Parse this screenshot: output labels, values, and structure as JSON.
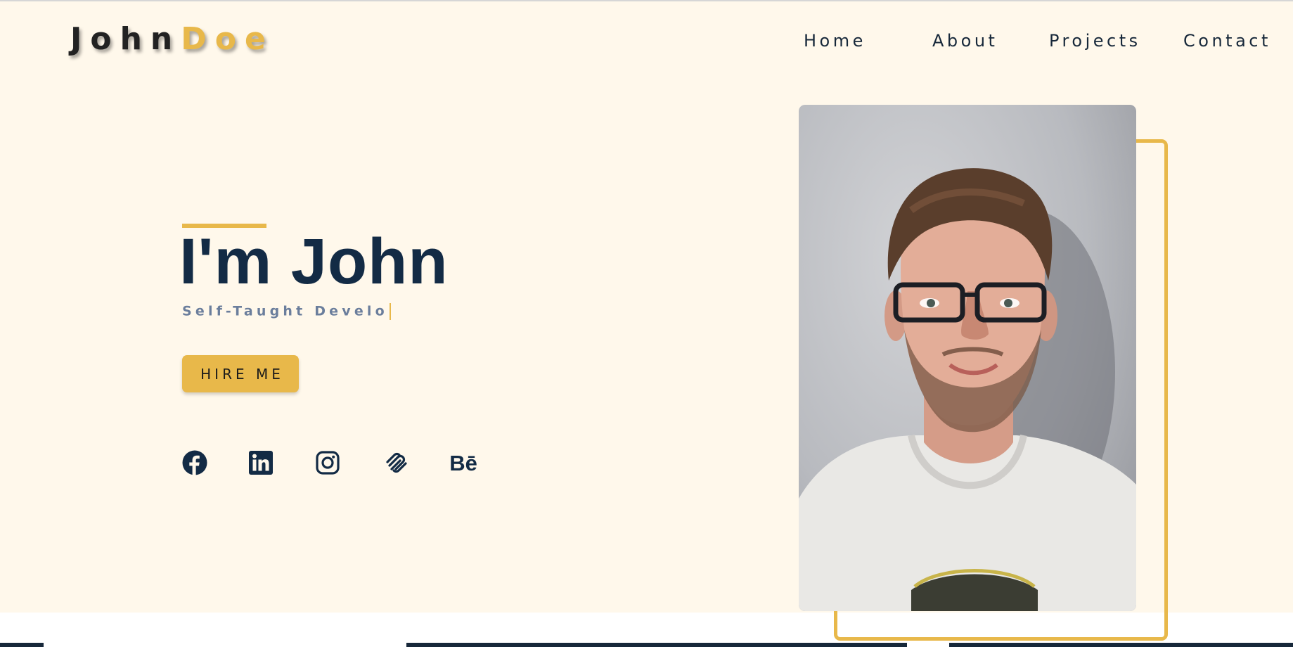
{
  "logo": {
    "first": "John",
    "last": "Doe"
  },
  "nav": {
    "home": "Home",
    "about": "About",
    "projects": "Projects",
    "contact": "Contact"
  },
  "hero": {
    "title": "I'm John",
    "subtitle": "Self-Taught Develo",
    "hire_label": "HIRE ME"
  },
  "socials": {
    "facebook": "facebook-icon",
    "linkedin": "linkedin-icon",
    "instagram": "instagram-icon",
    "squarespace": "squarespace-icon",
    "behance": "Bē"
  },
  "colors": {
    "background": "#fff8eb",
    "accent": "#e8b84a",
    "navy": "#132b45",
    "subtitle": "#6b7e9c"
  }
}
